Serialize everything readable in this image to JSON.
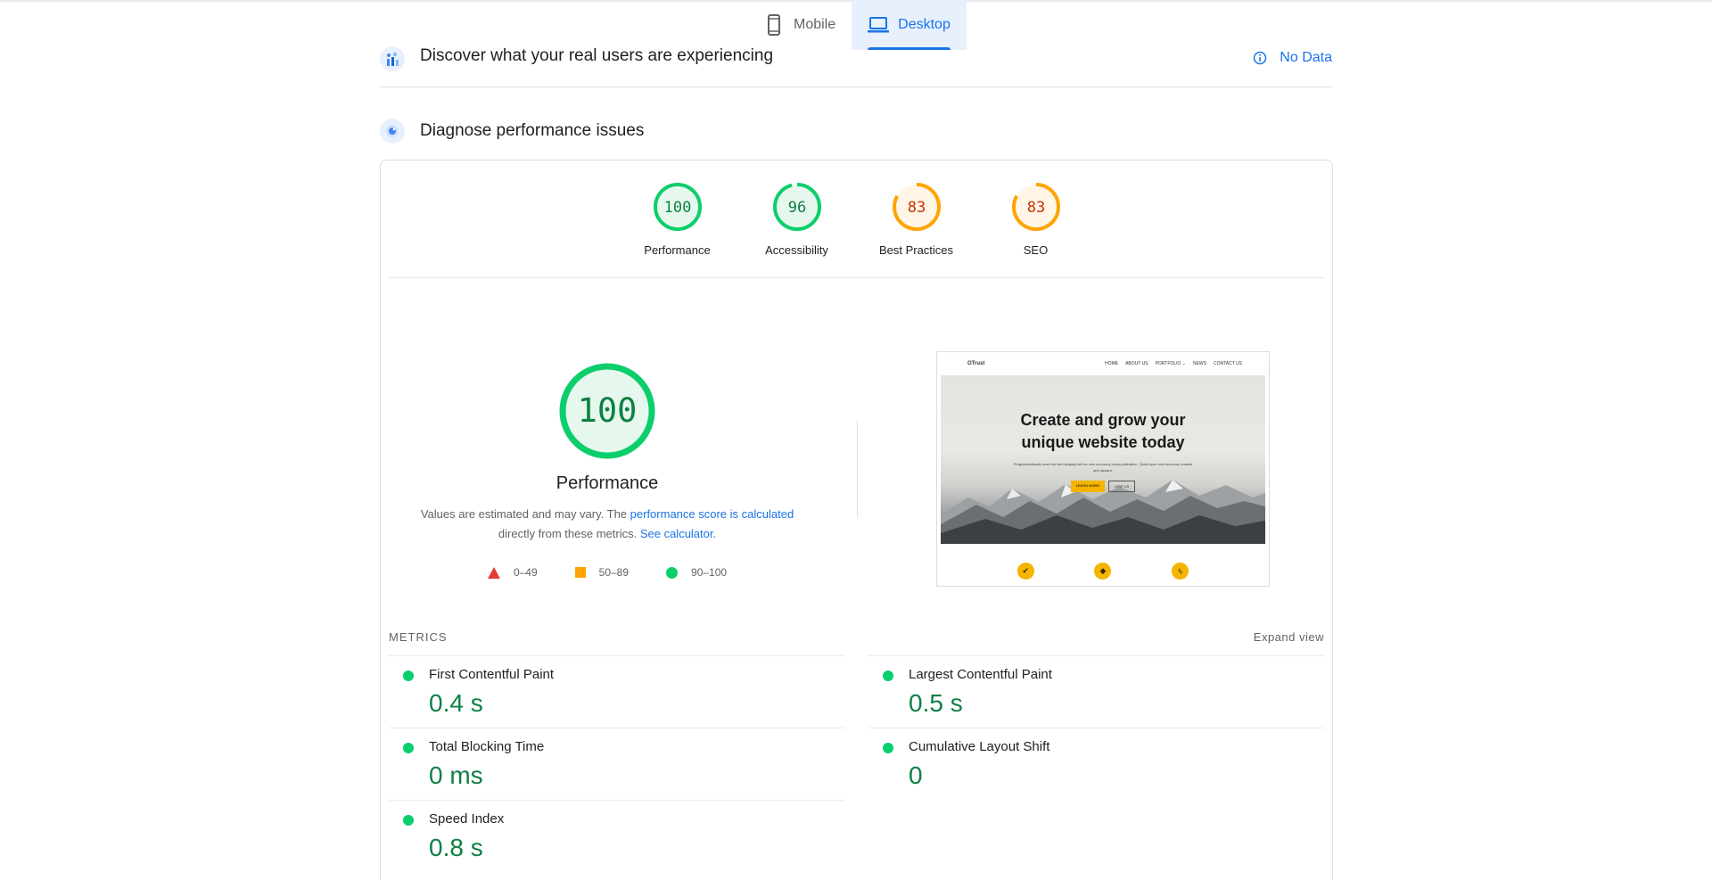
{
  "tabs": [
    {
      "label": "Mobile",
      "icon": "phone-icon",
      "active": false
    },
    {
      "label": "Desktop",
      "icon": "laptop-icon",
      "active": true
    }
  ],
  "field_data": {
    "title": "Discover what your real users are experiencing",
    "status_label": "No Data"
  },
  "diagnose": {
    "title": "Diagnose performance issues"
  },
  "categories": [
    {
      "label": "Performance",
      "score": "100",
      "rating": "pass"
    },
    {
      "label": "Accessibility",
      "score": "96",
      "rating": "pass"
    },
    {
      "label": "Best Practices",
      "score": "83",
      "rating": "average"
    },
    {
      "label": "SEO",
      "score": "83",
      "rating": "average"
    }
  ],
  "performance": {
    "score": "100",
    "title": "Performance",
    "desc_prefix": "Values are estimated and may vary. The ",
    "desc_link1": "performance score is calculated",
    "desc_middle": " directly from these metrics. ",
    "desc_link2": "See calculator.",
    "legend": [
      {
        "range": "0–49",
        "color": "#e53935"
      },
      {
        "range": "50–89",
        "color": "#ffa400"
      },
      {
        "range": "90–100",
        "color": "#0cce6b"
      }
    ]
  },
  "screenshot": {
    "logo": "OTrust",
    "menu": [
      "HOME",
      "ABOUT US",
      "PORTFOLIO ⌄",
      "NEWS",
      "CONTACT US"
    ],
    "heading_line1": "Create and grow your",
    "heading_line2": "unique website today",
    "paragraph": "Programmatically work but low hanging fruit so new economy cross-pollination. Quick sync new economy onward and upward.",
    "button1": "LEARN MORE",
    "button2": "HIRE US"
  },
  "metrics": {
    "heading": "METRICS",
    "expand_label": "Expand view",
    "left": [
      {
        "name": "First Contentful Paint",
        "value": "0.4 s"
      },
      {
        "name": "Total Blocking Time",
        "value": "0 ms"
      },
      {
        "name": "Speed Index",
        "value": "0.8 s"
      }
    ],
    "right": [
      {
        "name": "Largest Contentful Paint",
        "value": "0.5 s"
      },
      {
        "name": "Cumulative Layout Shift",
        "value": "0"
      }
    ]
  },
  "colors": {
    "accent": "#1a73e8",
    "pass": "#0cce6b",
    "pass_text": "#0d8043",
    "average": "#ffa400",
    "average_text": "#c33300",
    "fail": "#e53935"
  }
}
